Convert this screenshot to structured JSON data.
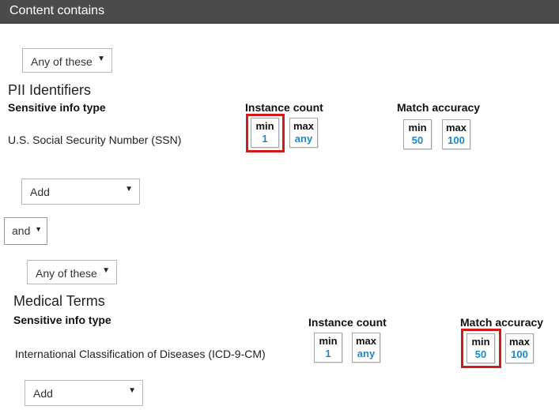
{
  "header": {
    "title": "Content contains"
  },
  "groups": [
    {
      "operator": "Any of these",
      "name": "PII Identifiers",
      "column_header": "Sensitive info type",
      "instance_count_label": "Instance count",
      "match_accuracy_label": "Match accuracy",
      "row": {
        "label": "U.S. Social Security Number (SSN)",
        "instance_min": {
          "label": "min",
          "value": "1"
        },
        "instance_max": {
          "label": "max",
          "value": "any"
        },
        "accuracy_min": {
          "label": "min",
          "value": "50"
        },
        "accuracy_max": {
          "label": "max",
          "value": "100"
        }
      },
      "add_label": "Add"
    },
    {
      "operator": "Any of these",
      "name": "Medical Terms",
      "column_header": "Sensitive info type",
      "instance_count_label": "Instance count",
      "match_accuracy_label": "Match accuracy",
      "row": {
        "label": "International Classification of Diseases (ICD-9-CM)",
        "instance_min": {
          "label": "min",
          "value": "1"
        },
        "instance_max": {
          "label": "max",
          "value": "any"
        },
        "accuracy_min": {
          "label": "min",
          "value": "50"
        },
        "accuracy_max": {
          "label": "max",
          "value": "100"
        }
      },
      "add_label": "Add"
    }
  ],
  "join_operator": "and",
  "colors": {
    "header_bg": "#4b4b4b",
    "value_blue": "#1e88c6",
    "highlight_red": "#d11a1a"
  }
}
